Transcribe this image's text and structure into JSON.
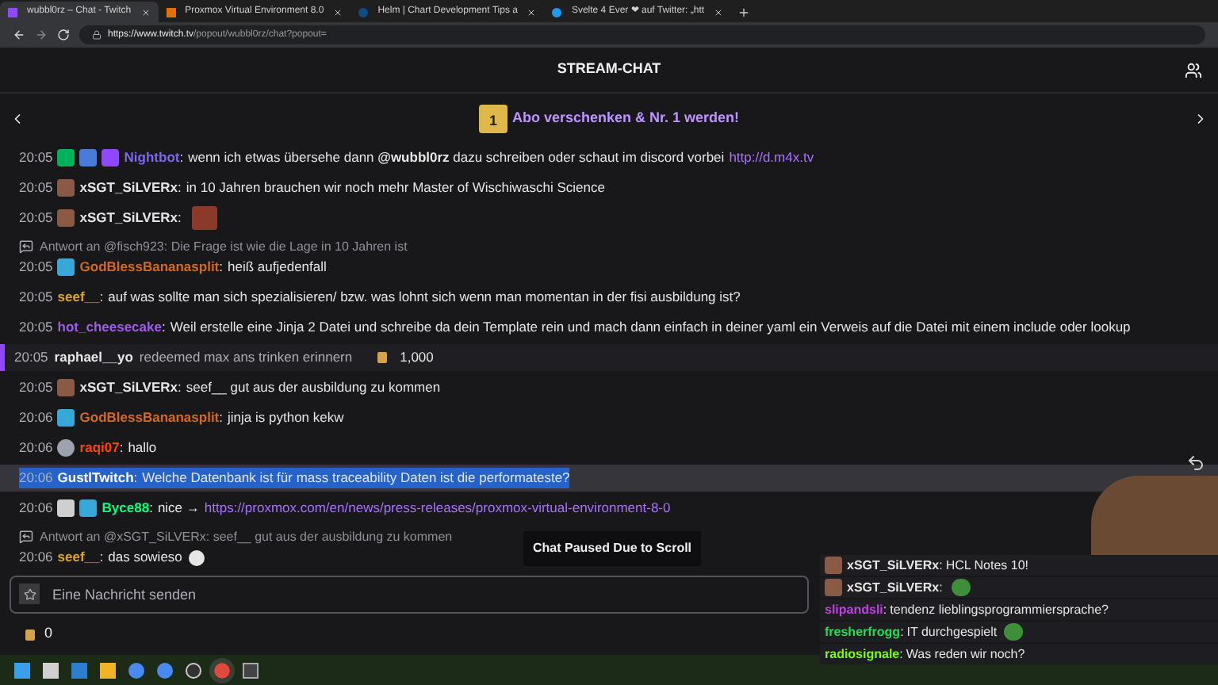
{
  "browser": {
    "tabs": [
      {
        "title": "wubbl0rz – Chat - Twitch",
        "selected": true,
        "kind": "twitch"
      },
      {
        "title": "Proxmox Virtual Environment 8.0",
        "selected": false,
        "kind": "proxmox"
      },
      {
        "title": "Helm | Chart Development Tips a",
        "selected": false,
        "kind": "helm"
      },
      {
        "title": "Svelte 4 Ever ❤ auf Twitter: „htt",
        "selected": false,
        "kind": "bird"
      }
    ],
    "url_host": "https://www.twitch.tv",
    "url_path": "/popout/wubbl0rz/chat?popout="
  },
  "header": {
    "title": "STREAM-CHAT"
  },
  "banner": {
    "text": "Abo verschenken & Nr. 1 werden!",
    "gift_count": "1"
  },
  "messages": [
    {
      "kind": "message",
      "time": "20:05",
      "badges": [
        {
          "kind": "verified"
        },
        {
          "kind": "moderator"
        },
        {
          "kind": "bot"
        }
      ],
      "user": "Nightbot",
      "color": "#7b68ee",
      "separator": ":",
      "text": "wenn ich etwas übersehe dann **@wubbl0rz** dazu schreiben oder schaut im discord vorbei",
      "link": "http://d.m4x.tv",
      "selected": false
    },
    {
      "kind": "message",
      "time": "20:05",
      "badges": [
        {
          "kind": "avatar"
        }
      ],
      "user": "xSGT_SiLVERx",
      "color": "#e5e5e5",
      "separator": ":",
      "text": "in 10 Jahren brauchen wir noch mehr Master of Wischiwaschi Science",
      "selected": false
    },
    {
      "kind": "message",
      "time": "20:05",
      "badges": [
        {
          "kind": "avatar"
        }
      ],
      "user": "xSGT_SiLVERx",
      "color": "#e5e5e5",
      "separator": ":",
      "emote": {
        "kind": "large"
      },
      "selected": false
    },
    {
      "kind": "message",
      "reply": "Antwort an @fisch923: Die Frage ist wie die Lage in 10 Jahren ist",
      "time": "20:05",
      "badges": [
        {
          "kind": "crown"
        }
      ],
      "user": "GodBlessBananasplit",
      "color": "#d2691e",
      "separator": ":",
      "text": "heiß aufjedenfall",
      "selected": false
    },
    {
      "kind": "message",
      "time": "20:05",
      "user": "seef__",
      "color": "#daa520",
      "separator": ":",
      "text": "auf was sollte man sich spezialisieren/ bzw. was lohnt sich wenn man momentan in der fisi ausbildung ist?",
      "selected": false
    },
    {
      "kind": "message",
      "time": "20:05",
      "user": "hot_cheesecake",
      "color": "#9b5de5",
      "separator": ":",
      "text": "Weil erstelle eine Jinja 2 Datei und schreibe da dein Template rein und mach dann einfach in deiner yaml ein Verweis auf die Datei mit einem include oder lookup",
      "selected": false
    },
    {
      "kind": "redemption",
      "time": "20:05",
      "user": "raphael__yo",
      "action": "redeemed",
      "reward": "max ans trinken erinnern",
      "cost": "1,000"
    },
    {
      "kind": "message",
      "time": "20:05",
      "badges": [
        {
          "kind": "avatar"
        }
      ],
      "user": "xSGT_SiLVERx",
      "color": "#e5e5e5",
      "separator": ":",
      "text": "seef__ gut aus der ausbildung zu kommen",
      "selected": false
    },
    {
      "kind": "message",
      "time": "20:06",
      "badges": [
        {
          "kind": "crown"
        }
      ],
      "user": "GodBlessBananasplit",
      "color": "#d2691e",
      "separator": ":",
      "text": "jinja is python kekw",
      "selected": false
    },
    {
      "kind": "message",
      "time": "20:06",
      "badges": [
        {
          "kind": "globe"
        }
      ],
      "user": "raqi07",
      "color": "#ff4500",
      "separator": ":",
      "text": "hallo",
      "selected": false
    },
    {
      "kind": "message",
      "time": "20:06",
      "user": "GustlTwitch",
      "color": "#ffffff",
      "separator": ":",
      "text": "Welche Datenbank ist für mass traceability Daten ist die performateste?",
      "selected": true
    },
    {
      "kind": "message",
      "time": "20:06",
      "badges": [
        {
          "kind": "robot"
        },
        {
          "kind": "crown"
        }
      ],
      "user": "Byce88",
      "color": "#00ff7f",
      "separator": ":",
      "text": "nice →",
      "link": "https://proxmox.com/en/news/press-releases/proxmox-virtual-environment-8-0",
      "selected": false
    },
    {
      "kind": "message",
      "reply": "Antwort an @xSGT_SiLVERx: seef__ gut aus der ausbildung zu kommen",
      "time": "20:06",
      "user": "seef__",
      "color": "#daa520",
      "separator": ":",
      "text": "das sowieso",
      "emote": {
        "kind": "small"
      },
      "selected": false
    }
  ],
  "paused_notice": "Chat Paused Due to Scroll",
  "input": {
    "placeholder": "Eine Nachricht senden"
  },
  "points": "0",
  "overlay": {
    "messages": [
      {
        "badges": [
          {
            "kind": "avatar"
          }
        ],
        "user": "xSGT_SiLVERx",
        "color": "#e5e5e5",
        "separator": ":",
        "text": "HCL Notes 10!"
      },
      {
        "badges": [
          {
            "kind": "avatar"
          }
        ],
        "user": "xSGT_SiLVERx",
        "color": "#e5e5e5",
        "separator": ":",
        "emote": {
          "kind": "frog"
        }
      },
      {
        "user": "slipandsli",
        "color": "#c040e0",
        "separator": ":",
        "text": "tendenz lieblingsprogrammiersprache?"
      },
      {
        "user": "fresherfrogg",
        "color": "#22dd55",
        "separator": ":",
        "text": "IT durchgespielt",
        "emote": {
          "kind": "frog"
        }
      },
      {
        "user": "radiosignale",
        "color": "#7cfc00",
        "separator": ":",
        "text": "Was reden wir noch?"
      }
    ]
  },
  "taskbar": {
    "apps": [
      {
        "kind": "start"
      },
      {
        "kind": "taskview"
      },
      {
        "kind": "widgets"
      },
      {
        "kind": "files"
      },
      {
        "kind": "browser-blue"
      },
      {
        "kind": "browser-blue"
      },
      {
        "kind": "obs"
      },
      {
        "kind": "chrome",
        "selected": true
      },
      {
        "kind": "terminal"
      }
    ]
  }
}
